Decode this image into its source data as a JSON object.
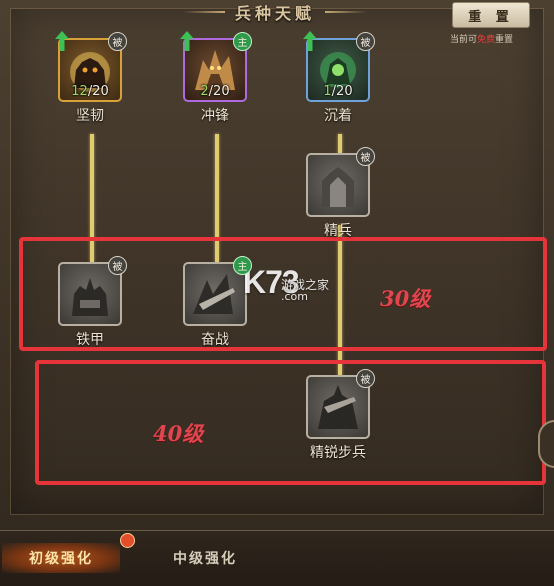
{
  "header": {
    "title": "兵种天赋",
    "reset_button": "重 置",
    "reset_note_prefix": "当前可",
    "reset_note_free": "免费",
    "reset_note_suffix": "重置"
  },
  "colors": {
    "connector": "#e0cb6e",
    "highlight": "#e5353a",
    "main_badge": "#2f9a4a",
    "free_text": "#e4413a"
  },
  "talents": {
    "tier1": [
      {
        "name": "坚韧",
        "badge": "被",
        "badge_type": "passive",
        "level_current": "12",
        "level_max": "/20",
        "icon": "fortress-beast-icon",
        "upgradable": true
      },
      {
        "name": "冲锋",
        "badge": "主",
        "badge_type": "active",
        "level_current": "2",
        "level_max": "/20",
        "icon": "charging-wolf-icon",
        "upgradable": true
      },
      {
        "name": "沉着",
        "badge": "被",
        "badge_type": "passive",
        "level_current": "1",
        "level_max": "/20",
        "icon": "calm-spirit-icon",
        "upgradable": true
      }
    ],
    "tier2": [
      {
        "name": "精兵",
        "badge": "被",
        "badge_type": "passive",
        "icon": "elite-soldier-icon"
      }
    ],
    "tier3": [
      {
        "name": "铁甲",
        "badge": "被",
        "badge_type": "passive",
        "icon": "iron-armor-icon"
      },
      {
        "name": "奋战",
        "badge": "主",
        "badge_type": "active",
        "icon": "fierce-battle-icon"
      }
    ],
    "tier4": [
      {
        "name": "精锐步兵",
        "badge": "被",
        "badge_type": "passive",
        "icon": "elite-infantry-icon"
      }
    ]
  },
  "annotations": {
    "level30": "30级",
    "level40": "40级"
  },
  "watermark": {
    "logo": "K73",
    "cn": "游戏之家",
    "domain": ".com"
  },
  "tabs": [
    {
      "label": "初级强化",
      "active": true,
      "has_dot": true
    },
    {
      "label": "中级强化",
      "active": false
    }
  ]
}
